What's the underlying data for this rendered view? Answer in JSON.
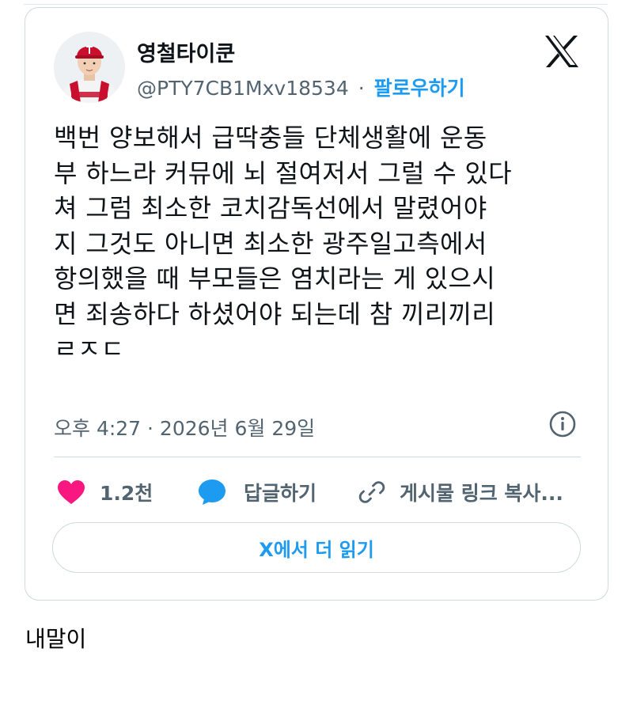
{
  "tweet": {
    "display_name": "영철타이쿤",
    "handle": "@PTY7CB1Mxv18534",
    "separator": "·",
    "follow_label": "팔로우하기",
    "text_lines": [
      "백번 양보해서 급딱충들 단체생활에 운동",
      "부 하느라 커뮤에 뇌 절여저서 그럴 수 있다",
      "쳐 그럼 최소한 코치감독선에서 말렸어야",
      "지 그것도 아니면 최소한 광주일고측에서",
      "항의했을 때 부모들은 염치라는 게 있으시",
      "면 죄송하다 하셨어야 되는데 참 끼리끼리",
      "ㄹㅈㄷ"
    ],
    "timestamp": "오후 4:27 · 2026년 6월 29일",
    "actions": {
      "like_count": "1.2천",
      "reply_label": "답글하기",
      "copy_link_label": "게시물 링크 복사..."
    },
    "read_more_label": "X에서 더 읽기",
    "colors": {
      "like": "#f91880",
      "reply": "#1d9bf0",
      "link": "#1d9bf0",
      "muted": "#536471"
    }
  },
  "caption": "내말이"
}
